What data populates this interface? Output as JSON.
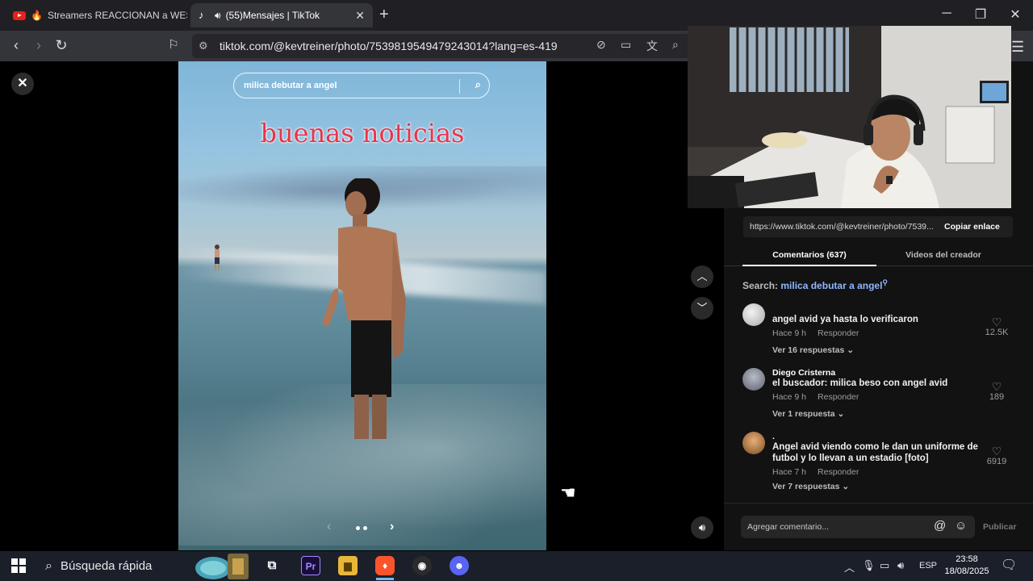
{
  "browser": {
    "tabs": [
      {
        "title": "Streamers REACCIONAN a WESTC",
        "prefix": "🔥",
        "icon": "youtube-icon"
      },
      {
        "title": "(55)Mensajes | TikTok",
        "icon": "tiktok-icon",
        "audio": "speaker-icon"
      }
    ],
    "new_tab": "+",
    "url": "tiktok.com/@kevtreiner/photo/7539819549479243014?lang=es-419",
    "window": {
      "minimize": "─",
      "restore": "❐",
      "close": "✕"
    }
  },
  "photo": {
    "search_text": "milica debutar a angel",
    "caption": "buenas noticias"
  },
  "right_panel": {
    "link_url": "https://www.tiktok.com/@kevtreiner/photo/7539...",
    "copy_link": "Copiar enlace",
    "tabs": {
      "comments": "Comentarios (637)",
      "creator": "Videos del creador"
    },
    "search_label": "Search:",
    "search_query": "milica debutar a angel",
    "search_glyph": "⚲",
    "comments": [
      {
        "name": "",
        "text": "angel avid ya hasta lo verificaron",
        "time": "Hace 9 h",
        "reply": "Responder",
        "replies": "Ver 16 respuestas",
        "likes": "12.5K",
        "avatar_color": "#cfcfcf"
      },
      {
        "name": "Diego Cristerna",
        "text": "el buscador: milica beso con angel avid",
        "time": "Hace 9 h",
        "reply": "Responder",
        "replies": "Ver 1 respuesta",
        "likes": "189",
        "avatar_color": "#8a8f9a"
      },
      {
        "name": ".",
        "text": "Angel avid viendo como le dan un uniforme de futbol y lo llevan a un estadio [foto]",
        "time": "Hace 7 h",
        "reply": "Responder",
        "replies": "Ver 7 respuestas",
        "likes": "6919",
        "avatar_color": "#c98a4f"
      }
    ],
    "comment_placeholder": "Agregar comentario...",
    "publish": "Publicar"
  },
  "taskbar": {
    "search": "Búsqueda rápida",
    "language": "ESP",
    "time": "23:58",
    "date": "18/08/2025",
    "apps": [
      "task-view",
      "premiere-pro",
      "file-explorer",
      "brave",
      "obs",
      "discord"
    ],
    "premiere_label": "Pr"
  },
  "colors": {
    "caption": "#e8344a",
    "link": "#8fb6ff",
    "panel": "#121212"
  }
}
